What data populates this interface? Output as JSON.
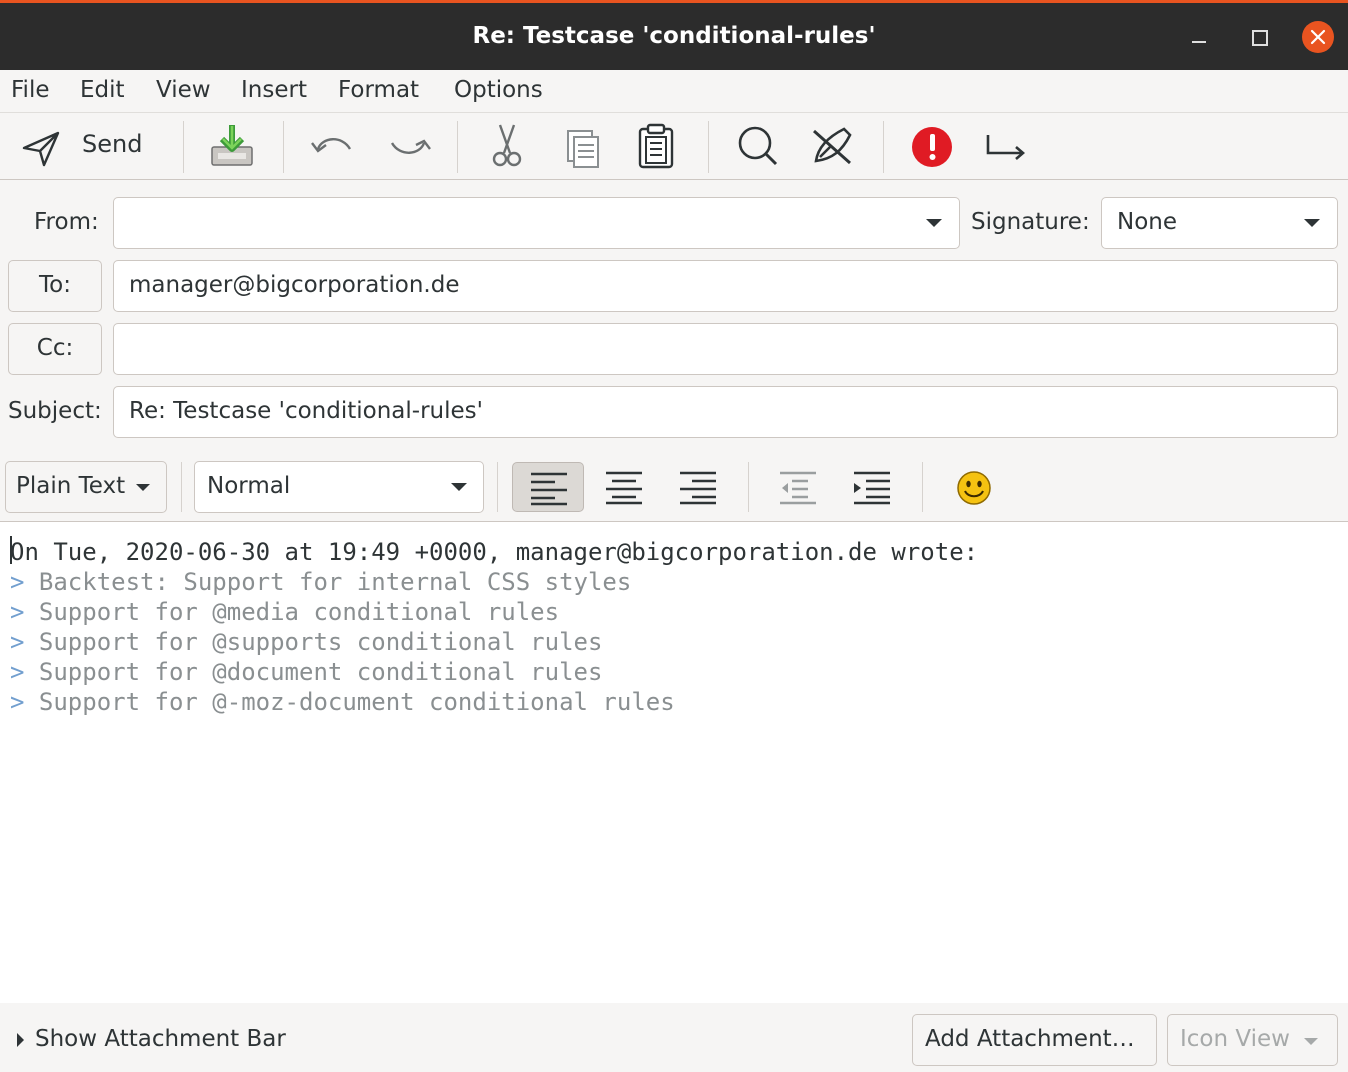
{
  "window": {
    "title": "Re: Testcase 'conditional-rules'"
  },
  "menu": [
    "File",
    "Edit",
    "View",
    "Insert",
    "Format",
    "Options"
  ],
  "toolbar": {
    "send_label": "Send"
  },
  "header": {
    "from_label": "From:",
    "from_value": "",
    "signature_label": "Signature:",
    "signature_value": "None",
    "to_label": "To:",
    "to_value": "manager@bigcorporation.de",
    "cc_label": "Cc:",
    "cc_value": "",
    "subject_label": "Subject:",
    "subject_value": "Re: Testcase 'conditional-rules'"
  },
  "format_bar": {
    "mode": "Plain Text",
    "paragraph_style": "Normal",
    "active_alignment": "left"
  },
  "body": {
    "attribution": "On Tue, 2020-06-30 at 19:49 +0000, manager@bigcorporation.de wrote:",
    "quote_marker": ">",
    "quoted_lines": [
      "Backtest: Support for internal CSS styles",
      "Support for @media conditional rules",
      "Support for @supports conditional rules",
      "Support for @document conditional rules",
      "Support for @-moz-document conditional rules"
    ]
  },
  "attachments": {
    "show_bar_label": "Show Attachment Bar",
    "add_label": "Add Attachment…",
    "view_label": "Icon View"
  },
  "colors": {
    "accent": "#e95420",
    "priority_red": "#e01b24",
    "quote_gray": "#8a8f91",
    "quote_marker": "#729fcf"
  }
}
